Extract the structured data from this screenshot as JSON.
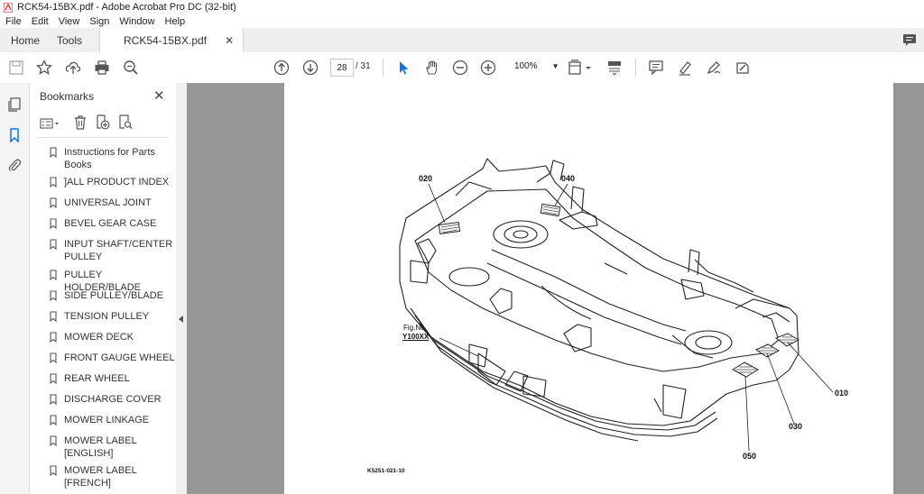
{
  "window": {
    "title": "RCK54-15BX.pdf - Adobe Acrobat Pro DC (32-bit)"
  },
  "menu": [
    "File",
    "Edit",
    "View",
    "Sign",
    "Window",
    "Help"
  ],
  "tabs": {
    "home": "Home",
    "tools": "Tools",
    "document": "RCK54-15BX.pdf",
    "close_glyph": "✕"
  },
  "toolbar": {
    "page_current": "28",
    "page_total": "/ 31",
    "zoom": "100%"
  },
  "bookmarks": {
    "title": "Bookmarks",
    "close_glyph": "✕",
    "items": [
      "Instructions for Parts Books",
      "]ALL PRODUCT INDEX",
      "UNIVERSAL JOINT",
      "BEVEL GEAR CASE",
      "INPUT SHAFT/CENTER PULLEY",
      "PULLEY HOLDER/BLADE",
      "SIDE PULLEY/BLADE",
      "TENSION PULLEY",
      "MOWER DECK",
      "FRONT GAUGE WHEEL",
      "REAR WHEEL",
      "DISCHARGE COVER",
      "MOWER LINKAGE",
      "MOWER LABEL [ENGLISH]",
      "MOWER LABEL [FRENCH]"
    ]
  },
  "drawing": {
    "callouts": {
      "c020": "020",
      "c040": "040",
      "c010": "010",
      "c030": "030",
      "c050": "050"
    },
    "fig_label": "Fig.No.",
    "fig_ref": "Y100XX",
    "code": "K5251-021-10"
  },
  "colors": {
    "accent": "#1473e6",
    "doc_bg": "#979797",
    "chrome": "#f0f0f0"
  },
  "icons": [
    "acrobat-icon",
    "save-icon",
    "star-icon",
    "upload-icon",
    "print-icon",
    "search-zoom-icon",
    "prev-page-icon",
    "next-page-icon",
    "select-arrow-icon",
    "hand-icon",
    "zoom-out-icon",
    "zoom-in-icon",
    "fit-page-icon",
    "scroll-mode-icon",
    "comment-icon",
    "highlight-icon",
    "draw-icon",
    "fill-sign-icon",
    "chat-icon",
    "pages-icon",
    "bookmark-icon",
    "attachment-icon"
  ]
}
